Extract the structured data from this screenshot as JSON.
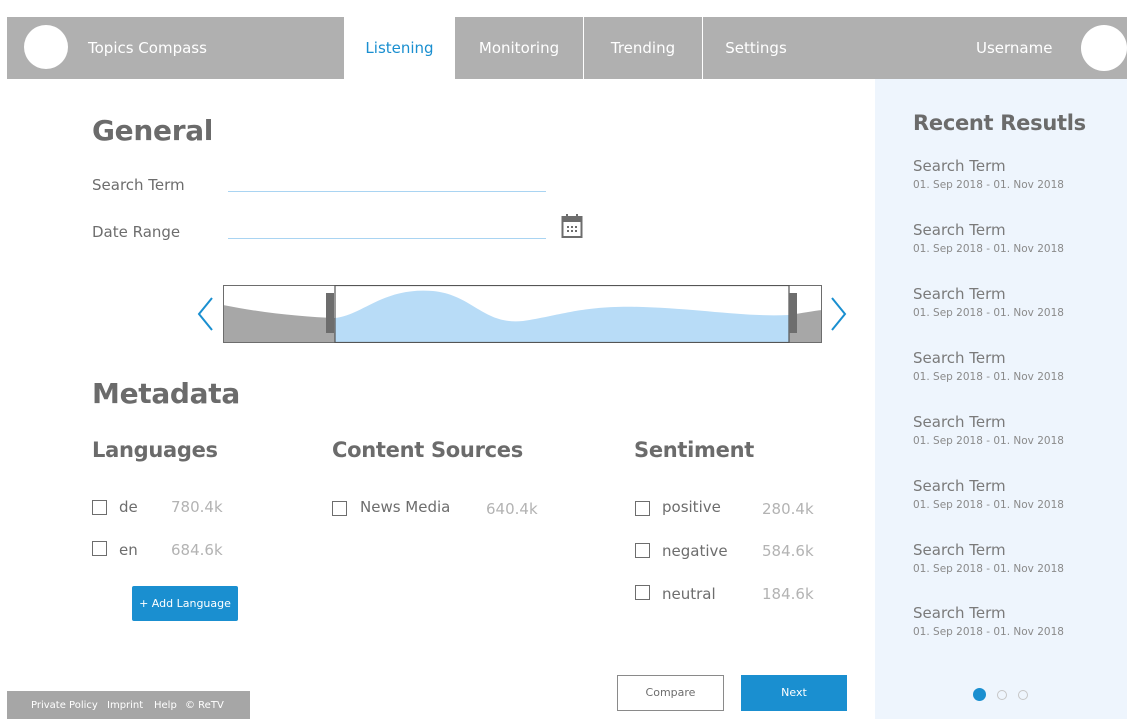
{
  "header": {
    "app_title": "Topics Compass",
    "tabs": [
      {
        "label": "Listening",
        "active": true
      },
      {
        "label": "Monitoring",
        "active": false
      },
      {
        "label": "Trending",
        "active": false
      },
      {
        "label": "Settings",
        "active": false
      }
    ],
    "username": "Username"
  },
  "general": {
    "heading": "General",
    "search_term_label": "Search Term",
    "date_range_label": "Date Range",
    "calendar_icon": "calendar-icon"
  },
  "timeline": {
    "prev_icon": "chevron-left-icon",
    "next_icon": "chevron-right-icon"
  },
  "metadata": {
    "heading": "Metadata",
    "languages": {
      "heading": "Languages",
      "items": [
        {
          "label": "de",
          "count": "780.4k"
        },
        {
          "label": "en",
          "count": "684.6k"
        }
      ],
      "add_button": "+ Add Language"
    },
    "content_sources": {
      "heading": "Content Sources",
      "items": [
        {
          "label": "News Media",
          "count": "640.4k"
        }
      ]
    },
    "sentiment": {
      "heading": "Sentiment",
      "items": [
        {
          "label": "positive",
          "count": "280.4k"
        },
        {
          "label": "negative",
          "count": "584.6k"
        },
        {
          "label": "neutral",
          "count": "184.6k"
        }
      ]
    }
  },
  "actions": {
    "compare": "Compare",
    "next": "Next"
  },
  "recent": {
    "heading": "Recent Resutls",
    "items": [
      {
        "term": "Search Term",
        "range": "01. Sep 2018 - 01. Nov 2018"
      },
      {
        "term": "Search Term",
        "range": "01. Sep 2018 - 01. Nov 2018"
      },
      {
        "term": "Search Term",
        "range": "01. Sep 2018 - 01. Nov 2018"
      },
      {
        "term": "Search Term",
        "range": "01. Sep 2018 - 01. Nov 2018"
      },
      {
        "term": "Search Term",
        "range": "01. Sep 2018 - 01. Nov 2018"
      },
      {
        "term": "Search Term",
        "range": "01. Sep 2018 - 01. Nov 2018"
      },
      {
        "term": "Search Term",
        "range": "01. Sep 2018 - 01. Nov 2018"
      },
      {
        "term": "Search Term",
        "range": "01. Sep 2018 - 01. Nov 2018"
      }
    ],
    "page_count": 3,
    "active_page": 1
  },
  "footer": {
    "links": [
      "Private Policy",
      "Imprint",
      "Help",
      "© ReTV"
    ]
  },
  "colors": {
    "accent": "#1a8fd0",
    "header_bg": "#b0b0b0",
    "panel_bg": "#eef5fd",
    "timeline_fill": "#b8dcf7"
  }
}
